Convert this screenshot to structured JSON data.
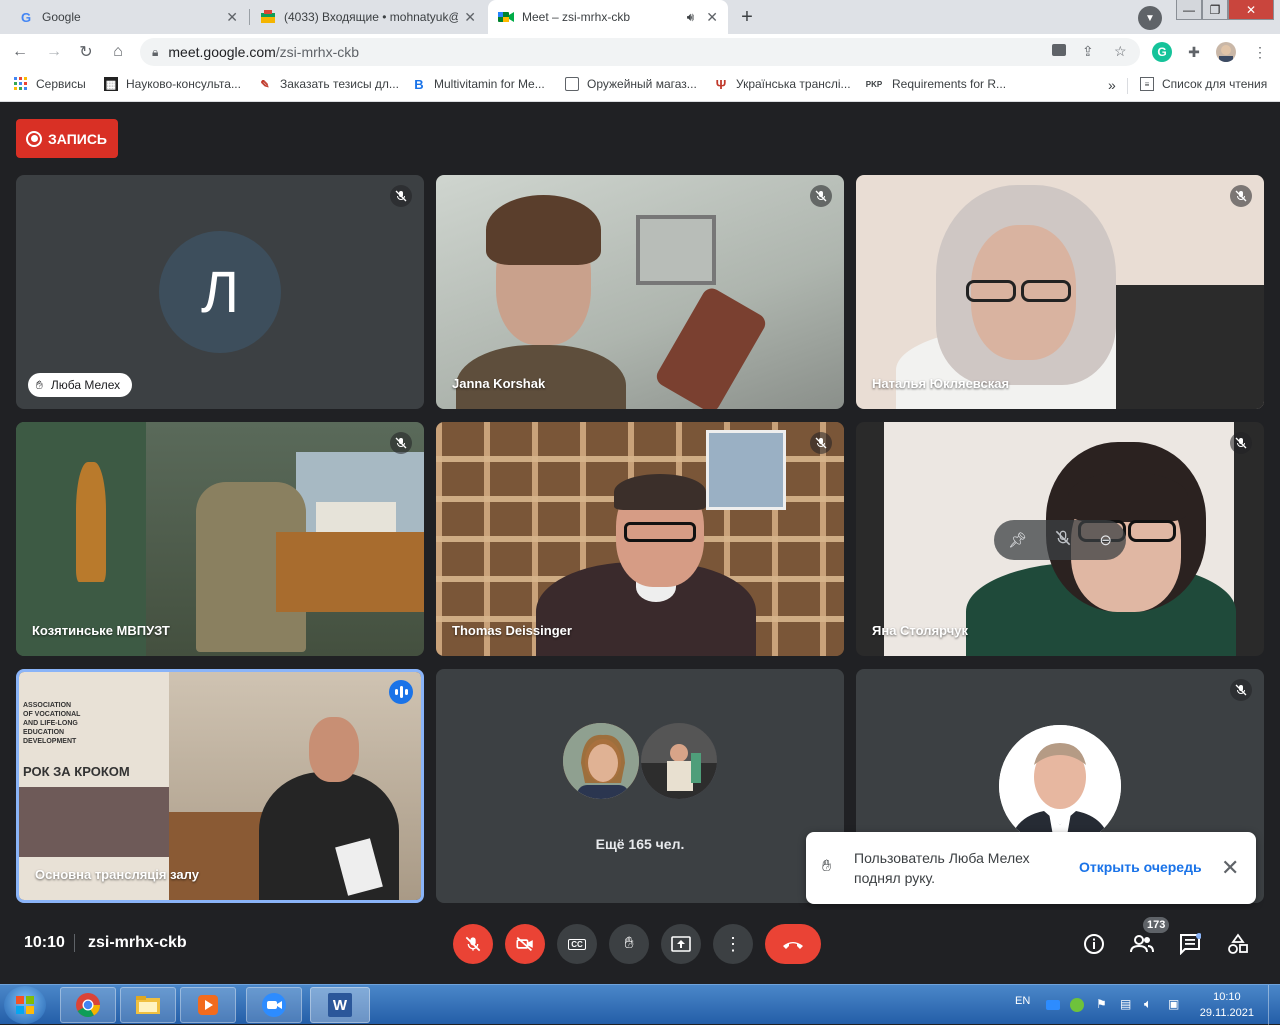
{
  "browser": {
    "tabs": [
      {
        "label": "Google",
        "icon": "google-icon",
        "active": false
      },
      {
        "label": "(4033) Входящие • mohnatyuk@",
        "icon": "mail-icon",
        "active": false
      },
      {
        "label": "Meet – zsi-mrhx-ckb",
        "icon": "meet-icon",
        "active": true
      }
    ],
    "url_host": "meet.google.com",
    "url_path": "/zsi-mrhx-ckb",
    "new_tab_symbol": "+"
  },
  "bookmarks": {
    "apps_label": "Сервисы",
    "items": [
      {
        "label": "Науково-консульта...",
        "icon": "science-icon"
      },
      {
        "label": "Заказать тезисы дл...",
        "icon": "cart-icon"
      },
      {
        "label": "Multivitamin for Me...",
        "icon": "b-icon"
      },
      {
        "label": "Оружейный магаз...",
        "icon": "shop-icon"
      },
      {
        "label": "Українська транслі...",
        "icon": "translit-icon"
      },
      {
        "label": "Requirements for R...",
        "icon": "pkp-icon"
      }
    ],
    "overflow": "»",
    "reading_list": "Список для чтения"
  },
  "meet": {
    "record_label": "ЗАПИСЬ",
    "tiles": [
      {
        "name": "Люба Мелех",
        "avatar_letter": "Л",
        "hand_raised": true
      },
      {
        "name": "Janna Korshak"
      },
      {
        "name": "Наталья Юкляевская"
      },
      {
        "name": "Козятинське МВПУЗТ"
      },
      {
        "name": "Thomas Deissinger"
      },
      {
        "name": "Яна Столярчук"
      },
      {
        "name": "Основна трансляція залу"
      },
      {
        "more_label": "Ещё 165 чел."
      },
      {
        "name": ""
      }
    ],
    "banner_lines": [
      "ASSOCIATION",
      "OF VOCATIONAL",
      "AND LIFE-LONG",
      "EDUCATION",
      "DEVELOPMENT"
    ],
    "banner_headline": "РОК ЗА КРОКОМ",
    "toast": {
      "message": "Пользователь Люба Мелех поднял руку.",
      "action": "Открыть очередь"
    },
    "bottom": {
      "time": "10:10",
      "code": "zsi-mrhx-ckb",
      "participants_count": "173"
    }
  },
  "taskbar": {
    "lang": "EN",
    "time": "10:10",
    "date": "29.11.2021",
    "word_label": "W"
  },
  "colors": {
    "record_red": "#d93025",
    "meet_bg": "#202124",
    "speaking_blue": "#1a73e8",
    "end_call_red": "#ea4335"
  }
}
